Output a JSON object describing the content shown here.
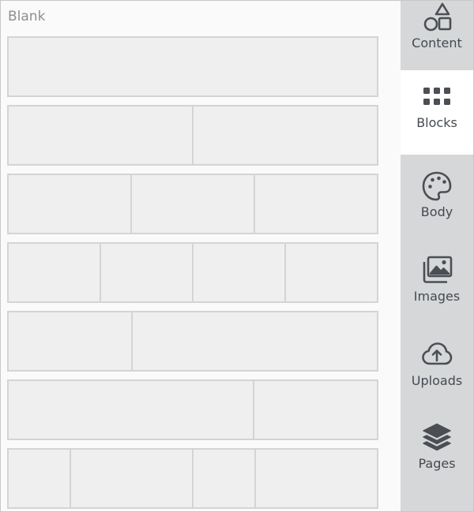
{
  "panel": {
    "title": "Blank"
  },
  "block_layouts": [
    {
      "cols": [
        1
      ]
    },
    {
      "cols": [
        1,
        1
      ]
    },
    {
      "cols": [
        1,
        1,
        1
      ]
    },
    {
      "cols": [
        1,
        1,
        1,
        1
      ]
    },
    {
      "cols": [
        1,
        2
      ]
    },
    {
      "cols": [
        2,
        1
      ]
    },
    {
      "cols": [
        1,
        2,
        1,
        2
      ]
    }
  ],
  "sidebar": {
    "active": "Blocks",
    "items": [
      {
        "label": "Content",
        "icon": "shapes-icon"
      },
      {
        "label": "Blocks",
        "icon": "grid-icon"
      },
      {
        "label": "Body",
        "icon": "palette-icon"
      },
      {
        "label": "Images",
        "icon": "images-icon"
      },
      {
        "label": "Uploads",
        "icon": "cloud-upload-icon"
      },
      {
        "label": "Pages",
        "icon": "layers-icon"
      }
    ]
  },
  "colors": {
    "sidebar_bg": "#d5d7d9",
    "active_bg": "#ffffff",
    "cell_fill": "#efefef",
    "cell_border": "#d4d4d4",
    "icon": "#4b4f54"
  }
}
